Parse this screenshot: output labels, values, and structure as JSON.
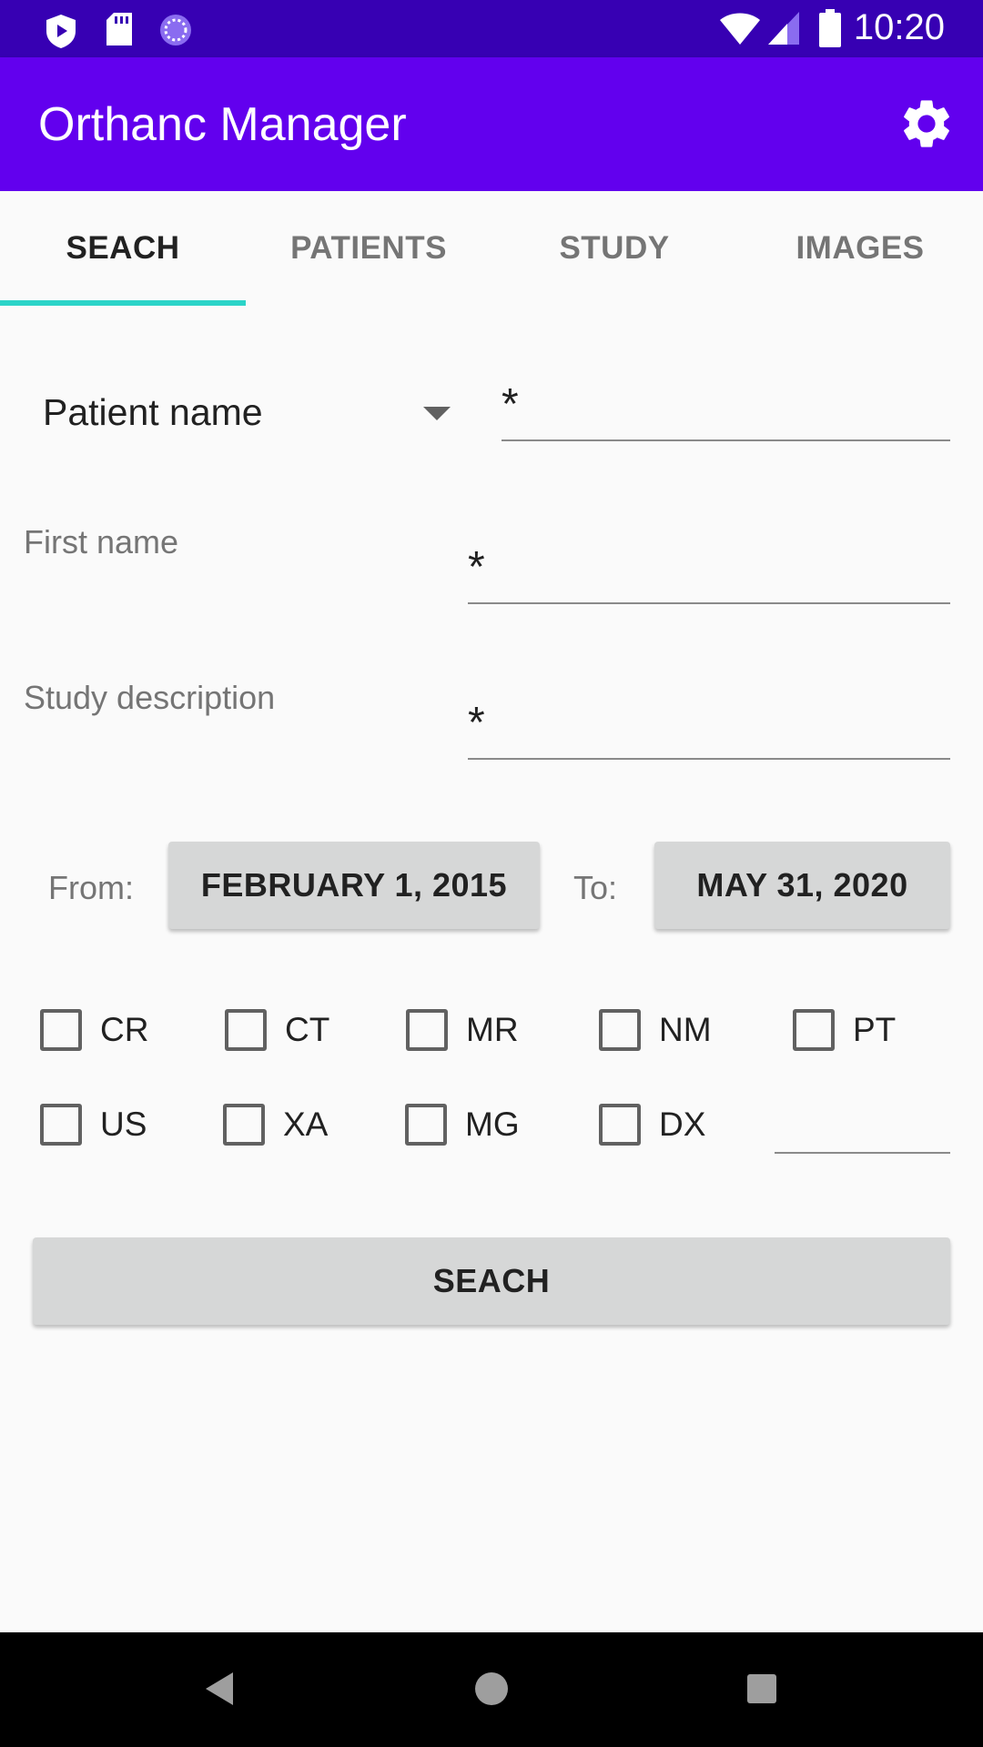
{
  "status_bar": {
    "time": "10:20",
    "left_icons": [
      "play-protect-icon",
      "sd-card-icon",
      "sync-icon"
    ],
    "right_icons": [
      "wifi-icon",
      "cell-signal-icon",
      "battery-icon"
    ]
  },
  "app_bar": {
    "title": "Orthanc Manager",
    "settings_icon": "gear-icon"
  },
  "tabs": [
    {
      "label": "SEACH",
      "active": true
    },
    {
      "label": "PATIENTS",
      "active": false
    },
    {
      "label": "STUDY",
      "active": false
    },
    {
      "label": "IMAGES",
      "active": false
    }
  ],
  "form": {
    "name_field_selector": {
      "selected": "Patient name"
    },
    "name_value": "*",
    "first_name": {
      "label": "First name",
      "value": "*"
    },
    "study_description": {
      "label": "Study description",
      "value": "*"
    },
    "date_range": {
      "from_label": "From:",
      "from_value": "FEBRUARY 1, 2015",
      "to_label": "To:",
      "to_value": "MAY 31, 2020"
    },
    "modalities": [
      {
        "label": "CR",
        "checked": false
      },
      {
        "label": "CT",
        "checked": false
      },
      {
        "label": "MR",
        "checked": false
      },
      {
        "label": "NM",
        "checked": false
      },
      {
        "label": "PT",
        "checked": false
      },
      {
        "label": "US",
        "checked": false
      },
      {
        "label": "XA",
        "checked": false
      },
      {
        "label": "MG",
        "checked": false
      },
      {
        "label": "DX",
        "checked": false
      }
    ],
    "other_modality_value": "",
    "search_button": "SEACH"
  },
  "colors": {
    "status_bar": "#3700B3",
    "app_bar": "#6200EE",
    "tab_indicator": "#2BD4C8",
    "button_bg": "#D6D7D7"
  }
}
